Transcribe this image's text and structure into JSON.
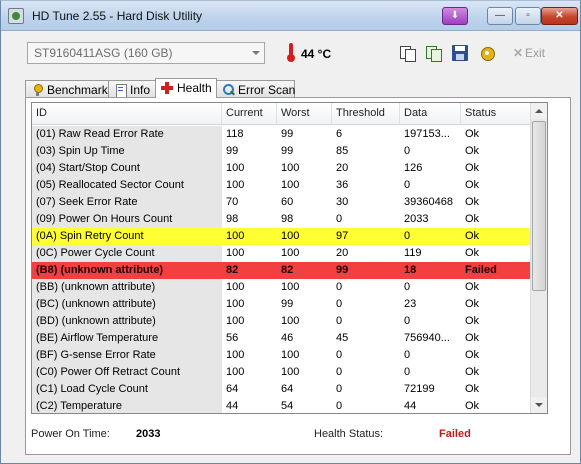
{
  "window": {
    "title": "HD Tune 2.55 - Hard Disk Utility",
    "controls": {
      "tray": "⬇",
      "minimize": "—",
      "maximize": "▫",
      "close": "✕"
    }
  },
  "toolbar": {
    "drive": "ST9160411ASG (160 GB)",
    "temperature": "44 °C",
    "icons": [
      "copy-icon",
      "copy-all-icon",
      "save-icon",
      "options-icon"
    ],
    "exit_label": "Exit"
  },
  "tabs": [
    {
      "label": "Benchmark",
      "icon": "benchmark-icon",
      "active": false
    },
    {
      "label": "Info",
      "icon": "info-icon",
      "active": false
    },
    {
      "label": "Health",
      "icon": "health-icon",
      "active": true
    },
    {
      "label": "Error Scan",
      "icon": "error-scan-icon",
      "active": false
    }
  ],
  "table": {
    "columns": [
      "ID",
      "Current",
      "Worst",
      "Threshold",
      "Data",
      "Status"
    ],
    "rows": [
      {
        "id": "(01) Raw Read Error Rate",
        "current": "118",
        "worst": "99",
        "threshold": "6",
        "data": "197153...",
        "status": "Ok",
        "highlight": ""
      },
      {
        "id": "(03) Spin Up Time",
        "current": "99",
        "worst": "99",
        "threshold": "85",
        "data": "0",
        "status": "Ok",
        "highlight": ""
      },
      {
        "id": "(04) Start/Stop Count",
        "current": "100",
        "worst": "100",
        "threshold": "20",
        "data": "126",
        "status": "Ok",
        "highlight": ""
      },
      {
        "id": "(05) Reallocated Sector Count",
        "current": "100",
        "worst": "100",
        "threshold": "36",
        "data": "0",
        "status": "Ok",
        "highlight": ""
      },
      {
        "id": "(07) Seek Error Rate",
        "current": "70",
        "worst": "60",
        "threshold": "30",
        "data": "39360468",
        "status": "Ok",
        "highlight": ""
      },
      {
        "id": "(09) Power On Hours Count",
        "current": "98",
        "worst": "98",
        "threshold": "0",
        "data": "2033",
        "status": "Ok",
        "highlight": ""
      },
      {
        "id": "(0A) Spin Retry Count",
        "current": "100",
        "worst": "100",
        "threshold": "97",
        "data": "0",
        "status": "Ok",
        "highlight": "yellow"
      },
      {
        "id": "(0C) Power Cycle Count",
        "current": "100",
        "worst": "100",
        "threshold": "20",
        "data": "119",
        "status": "Ok",
        "highlight": ""
      },
      {
        "id": "(B8) (unknown attribute)",
        "current": "82",
        "worst": "82",
        "threshold": "99",
        "data": "18",
        "status": "Failed",
        "highlight": "red"
      },
      {
        "id": "(BB) (unknown attribute)",
        "current": "100",
        "worst": "100",
        "threshold": "0",
        "data": "0",
        "status": "Ok",
        "highlight": ""
      },
      {
        "id": "(BC) (unknown attribute)",
        "current": "100",
        "worst": "99",
        "threshold": "0",
        "data": "23",
        "status": "Ok",
        "highlight": ""
      },
      {
        "id": "(BD) (unknown attribute)",
        "current": "100",
        "worst": "100",
        "threshold": "0",
        "data": "0",
        "status": "Ok",
        "highlight": ""
      },
      {
        "id": "(BE) Airflow Temperature",
        "current": "56",
        "worst": "46",
        "threshold": "45",
        "data": "756940...",
        "status": "Ok",
        "highlight": ""
      },
      {
        "id": "(BF) G-sense Error Rate",
        "current": "100",
        "worst": "100",
        "threshold": "0",
        "data": "0",
        "status": "Ok",
        "highlight": ""
      },
      {
        "id": "(C0) Power Off Retract Count",
        "current": "100",
        "worst": "100",
        "threshold": "0",
        "data": "0",
        "status": "Ok",
        "highlight": ""
      },
      {
        "id": "(C1) Load Cycle Count",
        "current": "64",
        "worst": "64",
        "threshold": "0",
        "data": "72199",
        "status": "Ok",
        "highlight": ""
      },
      {
        "id": "(C2) Temperature",
        "current": "44",
        "worst": "54",
        "threshold": "0",
        "data": "44",
        "status": "Ok",
        "highlight": ""
      }
    ]
  },
  "footer": {
    "power_on_label": "Power On Time:",
    "power_on_value": "2033",
    "health_label": "Health Status:",
    "health_value": "Failed"
  },
  "colors": {
    "highlight_yellow": "#ffff33",
    "highlight_red": "#f23f3f",
    "failed_text": "#c01818"
  }
}
